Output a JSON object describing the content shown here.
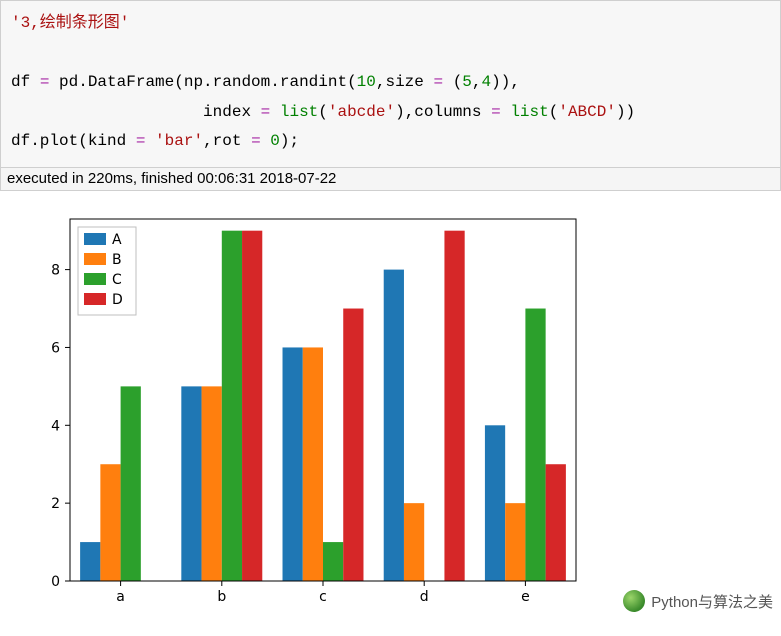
{
  "code": {
    "line1_str": "'3,绘制条形图'",
    "line2_pre": "df ",
    "line2_eq": "=",
    "line2_mid": " pd.DataFrame(np.random.randint(",
    "line2_n10": "10",
    "line2_comma_size": ",size ",
    "line2_eq2": "=",
    "line2_size_tuple": " (",
    "line2_n5": "5",
    "line2_c1": ",",
    "line2_n4": "4",
    "line2_close": ")),",
    "line3_pre": "                    index ",
    "line3_eq": "=",
    "line3_list1": " ",
    "line3_list_kw": "list",
    "line3_str1": "'abcde'",
    "line3_mid": "),columns ",
    "line3_eq2": "=",
    "line3_list2": " ",
    "line3_list_kw2": "list",
    "line3_str2": "'ABCD'",
    "line3_close": "))",
    "line4_pre": "df.plot(kind ",
    "line4_eq": "=",
    "line4_sp": " ",
    "line4_str": "'bar'",
    "line4_mid": ",rot ",
    "line4_eq2": "=",
    "line4_sp2": " ",
    "line4_n0": "0",
    "line4_end": ");"
  },
  "exec": "executed in 220ms, finished 00:06:31 2018-07-22",
  "chart_data": {
    "type": "bar",
    "categories": [
      "a",
      "b",
      "c",
      "d",
      "e"
    ],
    "series": [
      {
        "name": "A",
        "color": "#1f77b4",
        "values": [
          1,
          5,
          6,
          8,
          4
        ]
      },
      {
        "name": "B",
        "color": "#ff7f0e",
        "values": [
          3,
          5,
          6,
          2,
          2
        ]
      },
      {
        "name": "C",
        "color": "#2ca02c",
        "values": [
          5,
          9,
          1,
          0,
          7
        ]
      },
      {
        "name": "D",
        "color": "#d62728",
        "values": [
          0,
          9,
          7,
          9,
          3
        ]
      }
    ],
    "ylim": [
      0,
      9
    ],
    "yticks": [
      0,
      2,
      4,
      6,
      8
    ],
    "xlabel": "",
    "ylabel": "",
    "title": ""
  },
  "watermark": "Python与算法之美"
}
